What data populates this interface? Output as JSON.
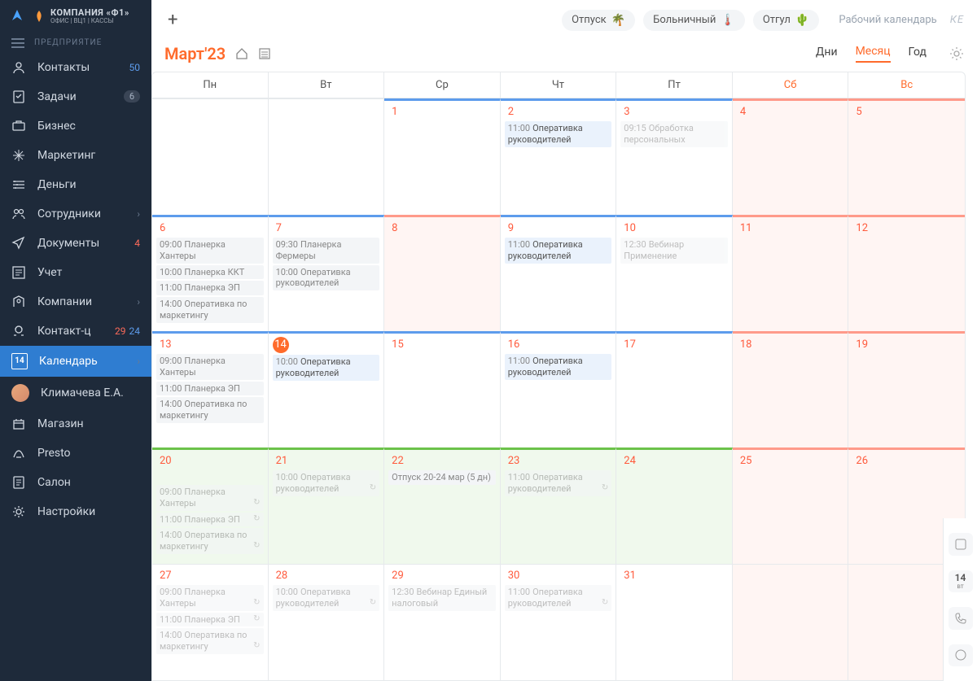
{
  "company": {
    "name": "КОМПАНИЯ «Ф1»",
    "sub": "ОФИС | ВЦ1 | КАССЫ"
  },
  "section_label": "ПРЕДПРИЯТИЕ",
  "sidebar": [
    {
      "label": "Контакты",
      "badge": "50",
      "btype": "num"
    },
    {
      "label": "Задачи",
      "badge": "6",
      "btype": "circle"
    },
    {
      "label": "Бизнес"
    },
    {
      "label": "Маркетинг"
    },
    {
      "label": "Деньги"
    },
    {
      "label": "Сотрудники",
      "chev": true
    },
    {
      "label": "Документы",
      "badge": "4",
      "btype": "red"
    },
    {
      "label": "Учет"
    },
    {
      "label": "Компании",
      "chev": true
    },
    {
      "label": "Контакт-ц",
      "badge": "29",
      "badge2": "24",
      "btype": "redblue"
    },
    {
      "label": "Календарь",
      "chev": true,
      "active": true,
      "calnum": "14"
    },
    {
      "label": "Климачева Е.А.",
      "avatar": true
    },
    {
      "label": "Магазин"
    },
    {
      "label": "Presto"
    },
    {
      "label": "Салон"
    },
    {
      "label": "Настройки"
    }
  ],
  "chips": [
    {
      "label": "Отпуск",
      "emoji": "🌴"
    },
    {
      "label": "Больничный",
      "emoji": "🌡️"
    },
    {
      "label": "Отгул",
      "emoji": "🌵"
    }
  ],
  "top_link": "Рабочий календарь",
  "top_ke": "КЕ",
  "title": "Март'23",
  "views": {
    "day": "Дни",
    "month": "Месяц",
    "year": "Год"
  },
  "weekdays": [
    "Пн",
    "Вт",
    "Ср",
    "Чт",
    "Пт",
    "Сб",
    "Вс"
  ],
  "rail_day": {
    "num": "14",
    "wd": "вт"
  },
  "cells": [
    [
      {
        "d": "",
        "cls": ""
      },
      {
        "d": "",
        "cls": ""
      },
      {
        "d": "1",
        "cls": "has-bar-blue"
      },
      {
        "d": "2",
        "cls": "has-bar-blue",
        "evts": [
          {
            "t": "11:00",
            "txt": "Оперативка руководителей",
            "s": "blue"
          }
        ]
      },
      {
        "d": "3",
        "cls": "has-bar-blue",
        "evts": [
          {
            "t": "09:15",
            "txt": "Обработка персональных",
            "s": "gray fade"
          }
        ]
      },
      {
        "d": "4",
        "cls": "weekend has-bar-red"
      },
      {
        "d": "5",
        "cls": "weekend has-bar-red"
      }
    ],
    [
      {
        "d": "6",
        "cls": "has-bar-blue",
        "evts": [
          {
            "t": "09:00",
            "txt": "Планерка Хантеры",
            "s": "gray"
          },
          {
            "t": "10:00",
            "txt": "Планерка ККТ",
            "s": "gray"
          },
          {
            "t": "11:00",
            "txt": "Планерка ЭП",
            "s": "gray"
          },
          {
            "t": "14:00",
            "txt": "Оперативка по маркетингу",
            "s": "gray"
          }
        ]
      },
      {
        "d": "7",
        "cls": "has-bar-blue",
        "evts": [
          {
            "t": "09:30",
            "txt": "Планерка Фермеры",
            "s": "gray"
          },
          {
            "t": "10:00",
            "txt": "Оперативка руководителей",
            "s": "gray"
          }
        ]
      },
      {
        "d": "8",
        "cls": "weekend has-bar-red"
      },
      {
        "d": "9",
        "cls": "has-bar-blue",
        "evts": [
          {
            "t": "11:00",
            "txt": "Оперативка руководителей",
            "s": "blue"
          }
        ]
      },
      {
        "d": "10",
        "cls": "has-bar-blue",
        "evts": [
          {
            "t": "12:30",
            "txt": "Вебинар Применение",
            "s": "gray fade"
          }
        ]
      },
      {
        "d": "11",
        "cls": "weekend has-bar-red"
      },
      {
        "d": "12",
        "cls": "weekend has-bar-red"
      }
    ],
    [
      {
        "d": "13",
        "cls": "has-bar-blue",
        "evts": [
          {
            "t": "09:00",
            "txt": "Планерка Хантеры",
            "s": "gray"
          },
          {
            "t": "11:00",
            "txt": "Планерка ЭП",
            "s": "gray"
          },
          {
            "t": "14:00",
            "txt": "Оперативка по маркетингу",
            "s": "gray"
          }
        ]
      },
      {
        "d": "14",
        "cls": "has-bar-blue",
        "today": true,
        "evts": [
          {
            "t": "10:00",
            "txt": "Оперативка руководителей",
            "s": "blue"
          }
        ]
      },
      {
        "d": "15",
        "cls": "has-bar-blue"
      },
      {
        "d": "16",
        "cls": "has-bar-blue",
        "evts": [
          {
            "t": "11:00",
            "txt": "Оперативка руководителей",
            "s": "blue"
          }
        ]
      },
      {
        "d": "17",
        "cls": "has-bar-blue"
      },
      {
        "d": "18",
        "cls": "weekend has-bar-red"
      },
      {
        "d": "19",
        "cls": "weekend has-bar-red"
      }
    ],
    [
      {
        "d": "20",
        "cls": "green has-bar-green",
        "vac_start": true,
        "evts": [
          {
            "t": "09:00",
            "txt": "Планерка Хантеры",
            "s": "gray fade",
            "r": true
          },
          {
            "t": "11:00",
            "txt": "Планерка ЭП",
            "s": "gray fade",
            "r": true
          },
          {
            "t": "14:00",
            "txt": "Оперативка по маркетингу",
            "s": "gray fade",
            "r": true
          }
        ]
      },
      {
        "d": "21",
        "cls": "green has-bar-green",
        "evts": [
          {
            "t": "10:00",
            "txt": "Оперативка руководителей",
            "s": "gray fade",
            "r": true
          }
        ]
      },
      {
        "d": "22",
        "cls": "green has-bar-green",
        "vac_label": "Отпуск 20-24 мар (5 дн)"
      },
      {
        "d": "23",
        "cls": "green has-bar-green",
        "evts": [
          {
            "t": "11:00",
            "txt": "Оперативка руководителей",
            "s": "gray fade",
            "r": true
          }
        ]
      },
      {
        "d": "24",
        "cls": "green has-bar-green"
      },
      {
        "d": "25",
        "cls": "weekend has-bar-red"
      },
      {
        "d": "26",
        "cls": "weekend has-bar-red"
      }
    ],
    [
      {
        "d": "27",
        "cls": "",
        "evts": [
          {
            "t": "09:00",
            "txt": "Планерка Хантеры",
            "s": "gray fade",
            "r": true
          },
          {
            "t": "11:00",
            "txt": "Планерка ЭП",
            "s": "gray fade",
            "r": true
          },
          {
            "t": "14:00",
            "txt": "Оперативка по маркетингу",
            "s": "gray fade",
            "r": true
          }
        ]
      },
      {
        "d": "28",
        "cls": "",
        "evts": [
          {
            "t": "10:00",
            "txt": "Оперативка руководителей",
            "s": "gray fade",
            "r": true
          }
        ]
      },
      {
        "d": "29",
        "cls": "",
        "evts": [
          {
            "t": "12:30",
            "txt": "Вебинар Единый налоговый",
            "s": "gray fade"
          }
        ]
      },
      {
        "d": "30",
        "cls": "",
        "evts": [
          {
            "t": "11:00",
            "txt": "Оперативка руководителей",
            "s": "gray fade",
            "r": true
          }
        ]
      },
      {
        "d": "31",
        "cls": ""
      },
      {
        "d": "",
        "cls": "weekend"
      },
      {
        "d": "",
        "cls": "weekend"
      }
    ]
  ]
}
